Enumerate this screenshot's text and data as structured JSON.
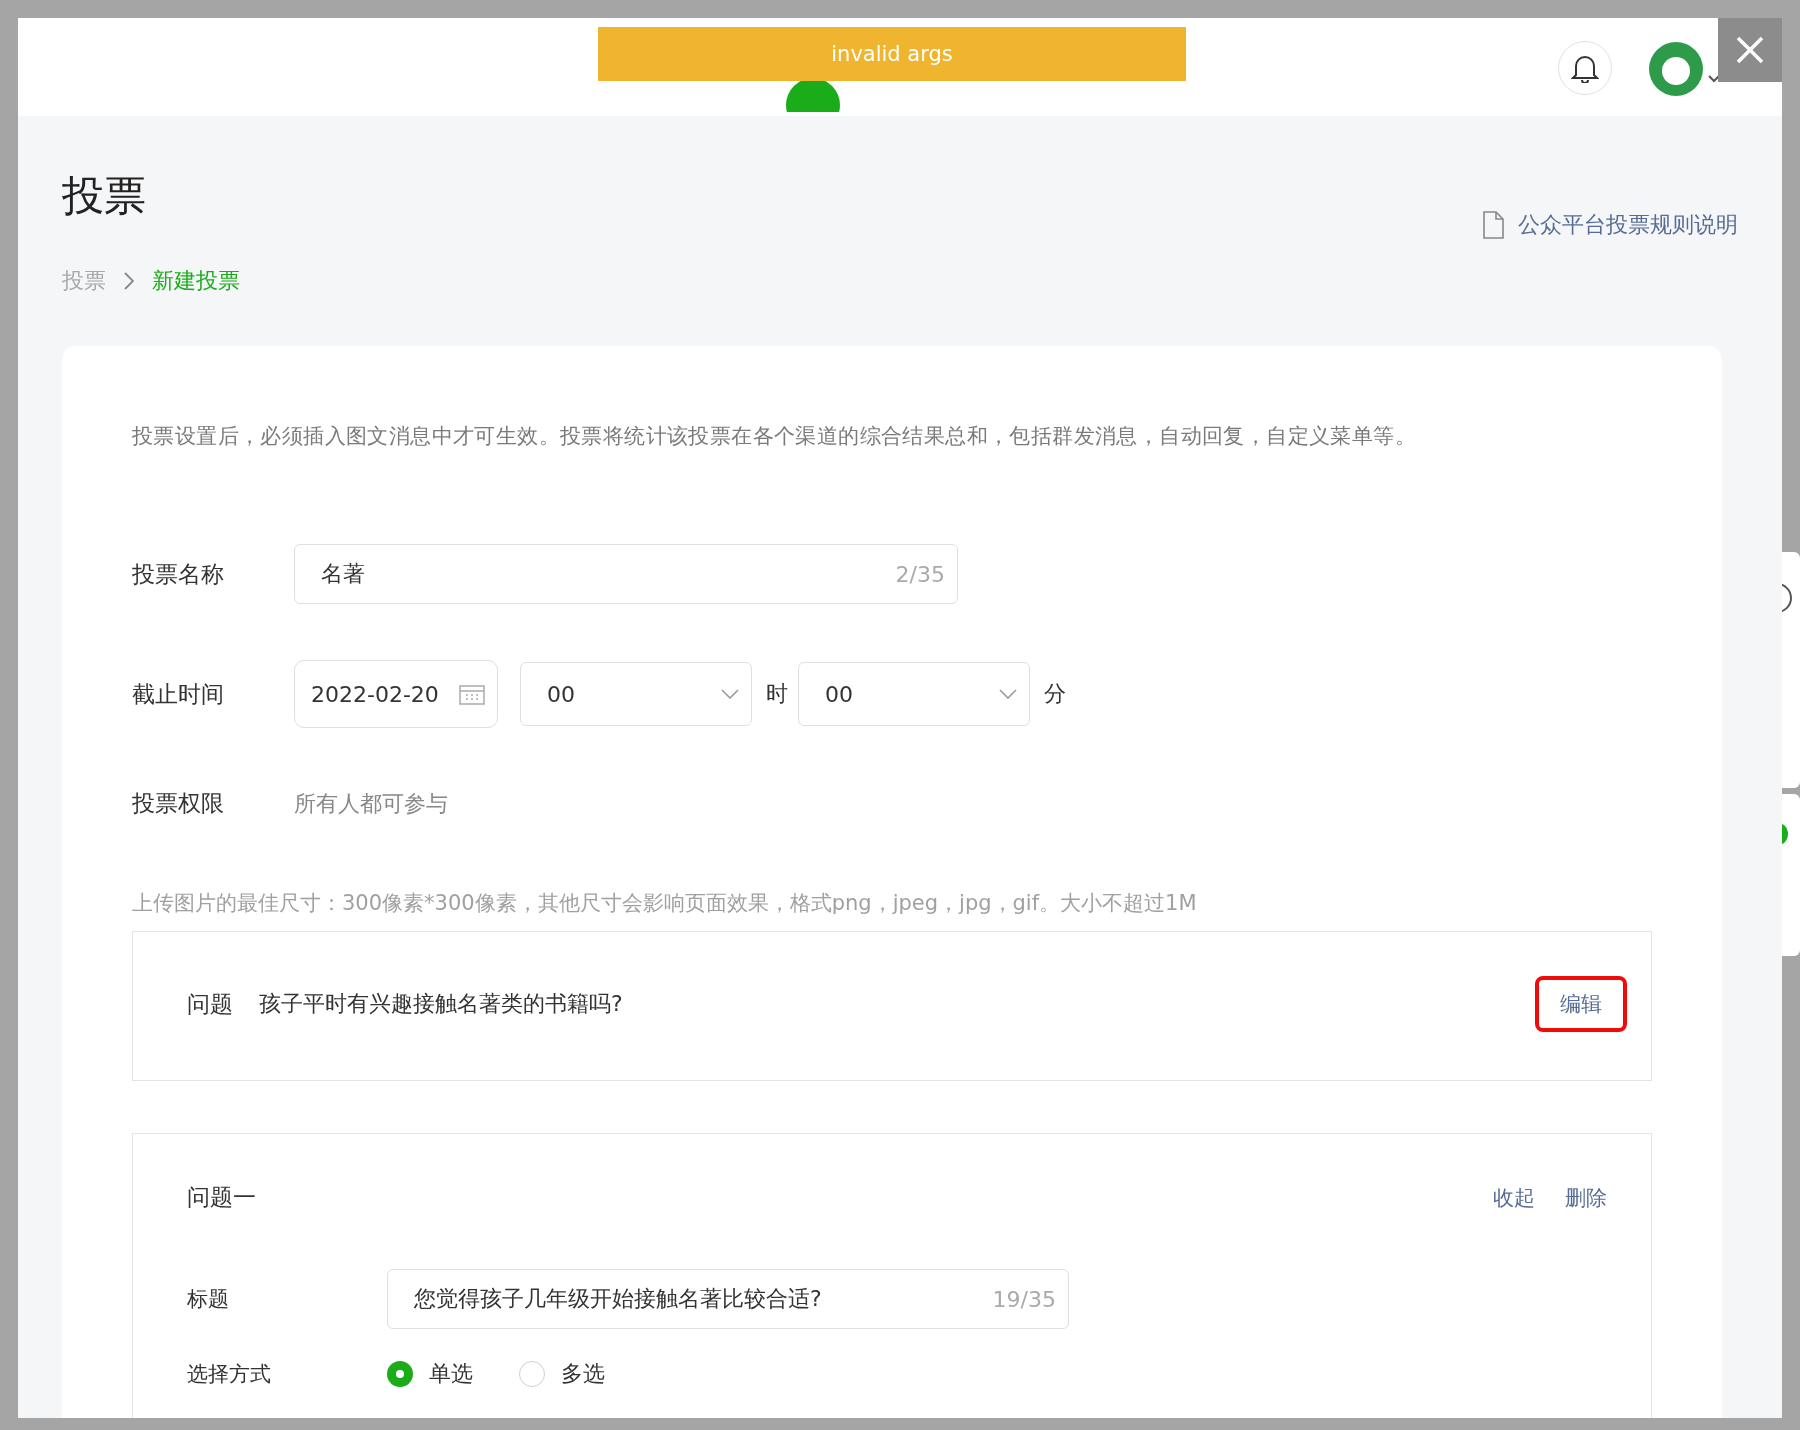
{
  "toast": {
    "text": "invalid args"
  },
  "page": {
    "title": "投票",
    "rules_link": "公众平台投票规则说明",
    "breadcrumb": [
      {
        "label": "投票",
        "selected": false
      },
      {
        "label": "新建投票",
        "selected": true
      }
    ]
  },
  "notice": "投票设置后，必须插入图文消息中才可生效。投票将统计该投票在各个渠道的综合结果总和，包括群发消息，自动回复，自定义菜单等。",
  "form": {
    "name": {
      "label": "投票名称",
      "value": "名著",
      "counter": "2/35"
    },
    "deadline": {
      "label": "截止时间",
      "date": "2022-02-20",
      "hour": "00",
      "hour_unit": "时",
      "minute": "00",
      "minute_unit": "分"
    },
    "permission": {
      "label": "投票权限",
      "value": "所有人都可参与"
    },
    "upload_hint": "上传图片的最佳尺寸：300像素*300像素，其他尺寸会影响页面效果，格式png，jpeg，jpg，gif。大小不超过1M"
  },
  "question_summary": {
    "label": "问题",
    "text": "孩子平时有兴趣接触名著类的书籍吗?",
    "edit": "编辑",
    "highlighted": true
  },
  "question": {
    "heading": "问题一",
    "actions": [
      "收起",
      "删除"
    ],
    "title": {
      "label": "标题",
      "value": "您觉得孩子几年级开始接触名著比较合适?",
      "counter": "19/35"
    },
    "mode": {
      "label": "选择方式",
      "options": [
        {
          "label": "单选",
          "selected": true
        },
        {
          "label": "多选",
          "selected": false
        }
      ]
    }
  }
}
